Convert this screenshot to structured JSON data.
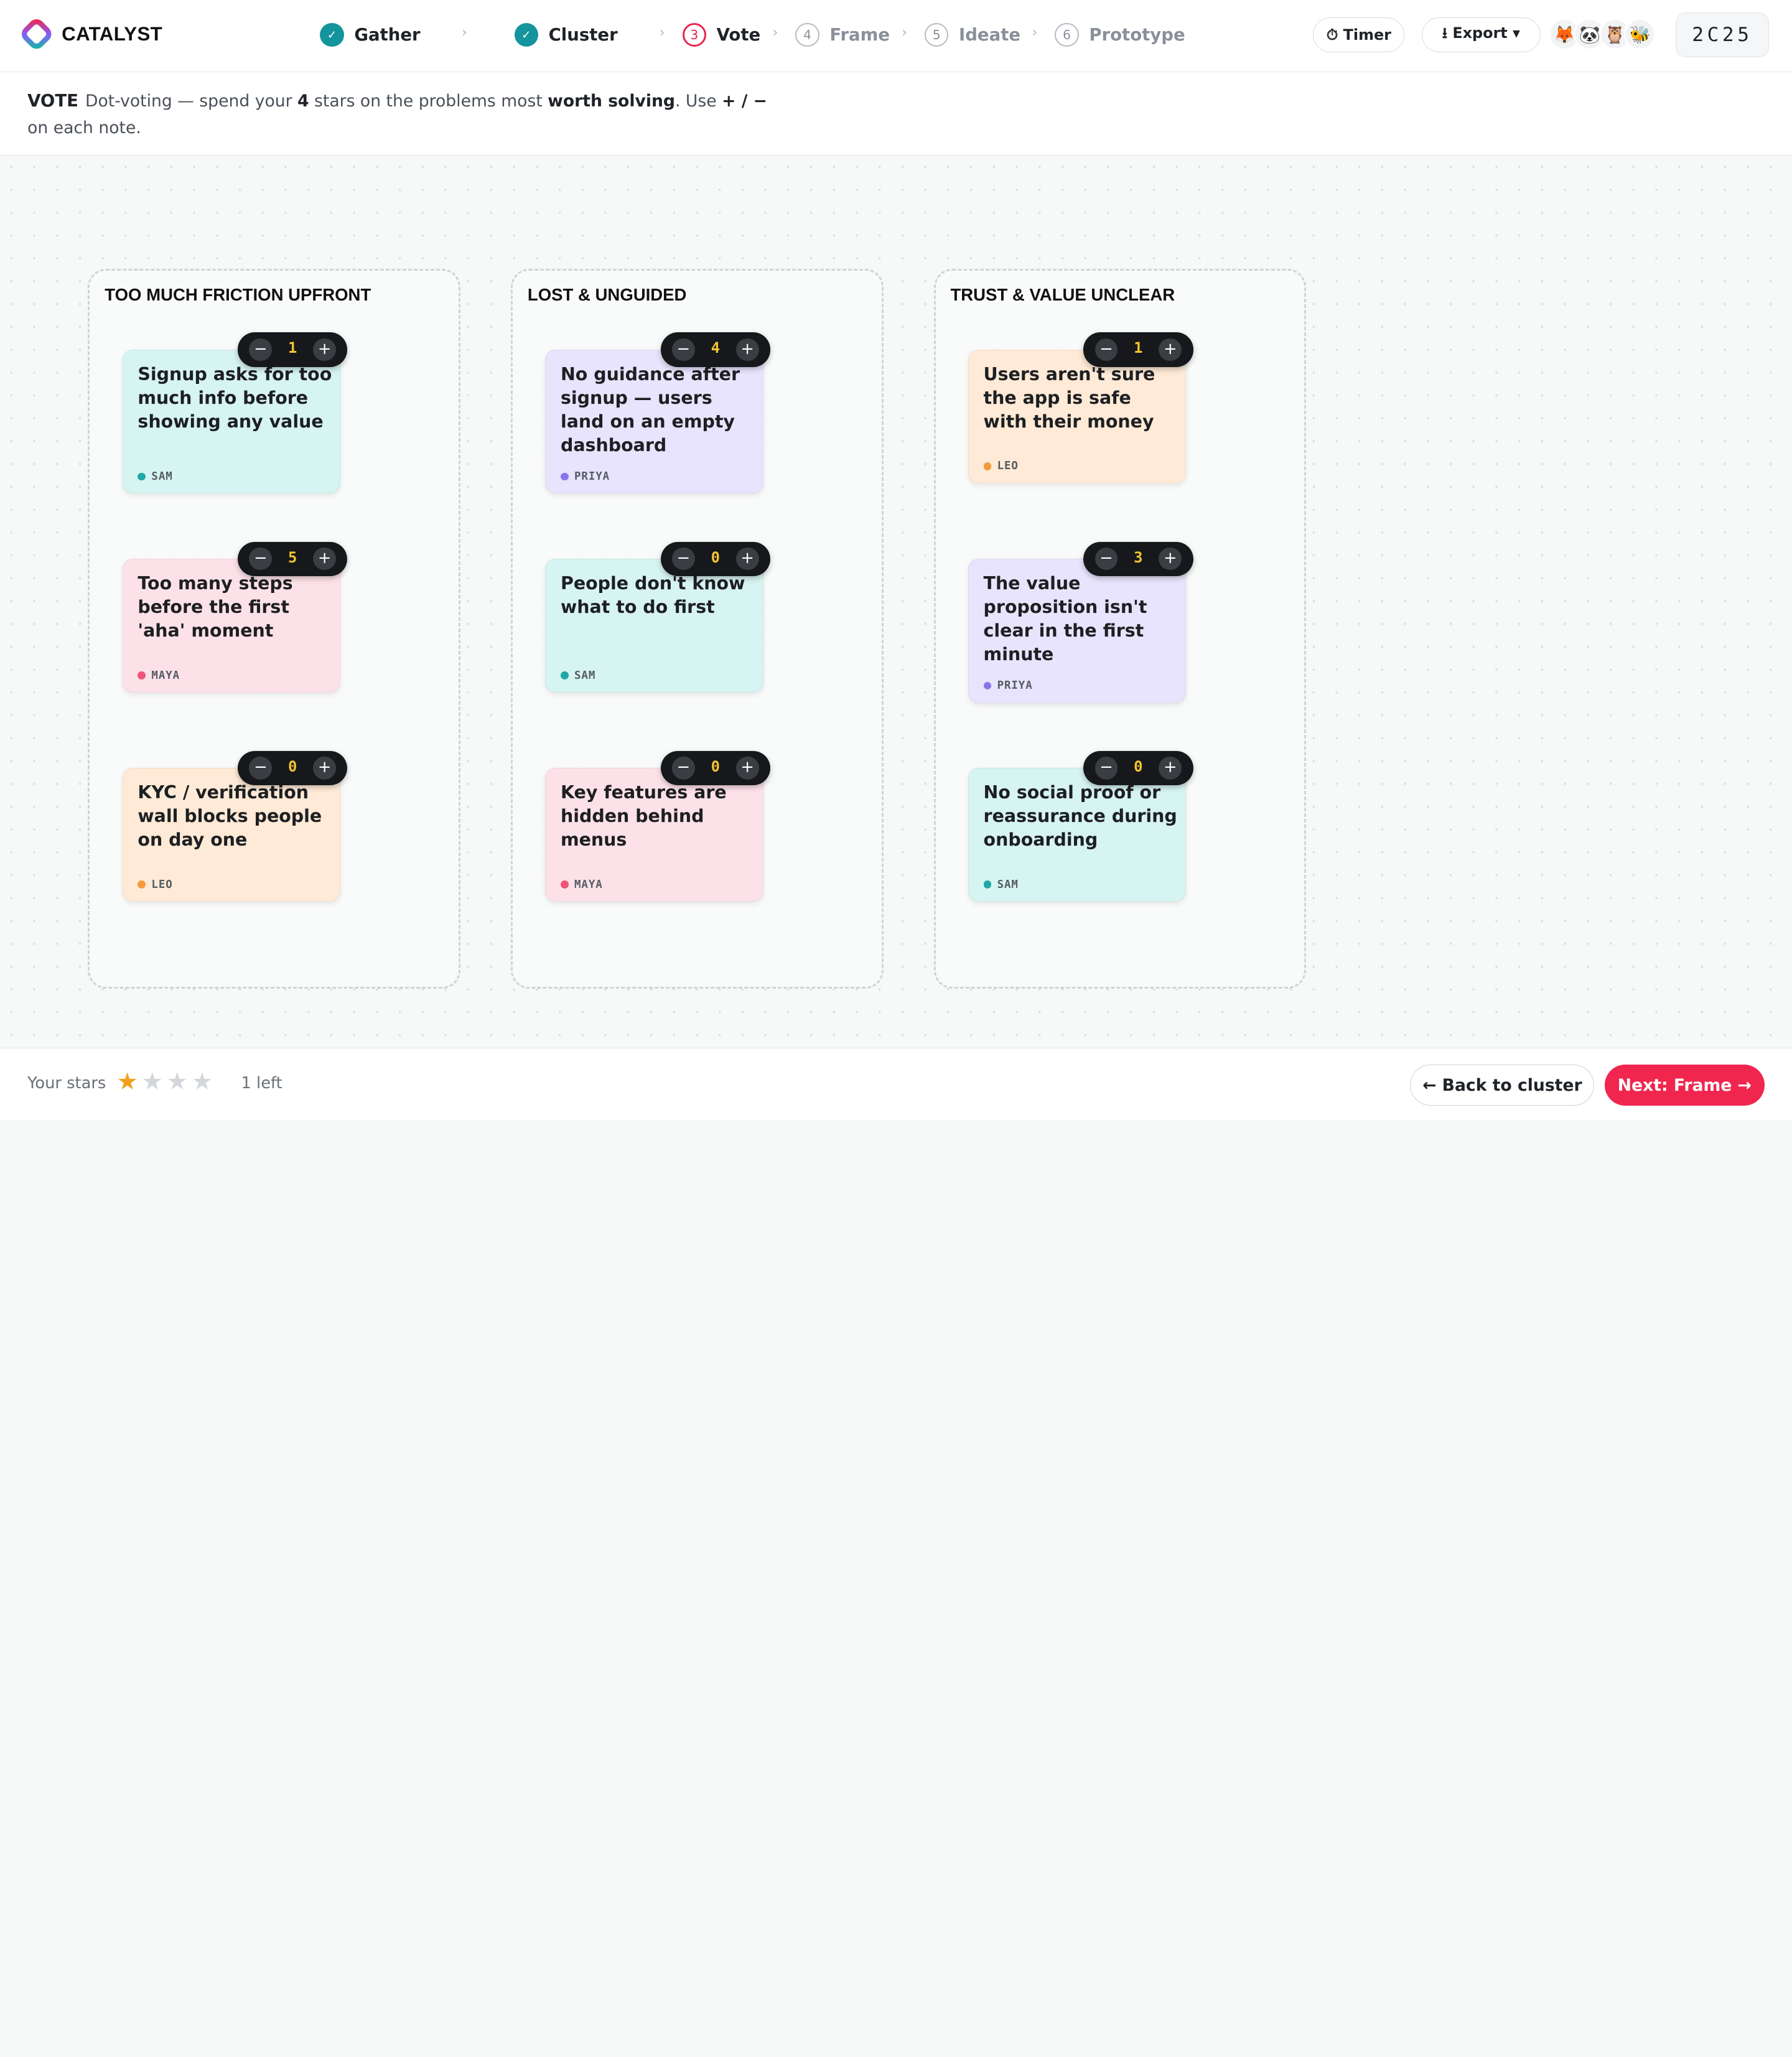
{
  "brand": {
    "name": "CATALYST",
    "accent": "#f0264f"
  },
  "steps": [
    {
      "num": "✓",
      "label": "Gather",
      "status": "done"
    },
    {
      "num": "✓",
      "label": "Cluster",
      "status": "done"
    },
    {
      "num": "3",
      "label": "Vote",
      "status": "current"
    },
    {
      "num": "4",
      "label": "Frame",
      "status": "todo"
    },
    {
      "num": "5",
      "label": "Ideate",
      "status": "todo"
    },
    {
      "num": "6",
      "label": "Prototype",
      "status": "todo"
    }
  ],
  "header": {
    "timer_label": "⏱ Timer",
    "export_label": "⭳ Export ▾",
    "avatars": [
      "🦊",
      "🐼",
      "🦉",
      "🐝"
    ],
    "room_code": "2C25"
  },
  "instruction": {
    "phase": "VOTE",
    "text_1": "Dot-voting — spend your ",
    "stars": "4",
    "text_2": " stars on the problems most ",
    "emph": "worth solving",
    "text_3": ". Use ",
    "keys": "+ / −",
    "text_4": " on each note."
  },
  "clusters": [
    {
      "title": "TOO MUCH FRICTION UPFRONT",
      "notes": [
        {
          "text": "Signup asks for too much info before showing any value",
          "author": "SAM",
          "votes": "1",
          "color": "teal"
        },
        {
          "text": "Too many steps before the first 'aha' moment",
          "author": "MAYA",
          "votes": "5",
          "color": "pink"
        },
        {
          "text": "KYC / verification wall blocks people on day one",
          "author": "LEO",
          "votes": "0",
          "color": "peach"
        }
      ]
    },
    {
      "title": "LOST & UNGUIDED",
      "notes": [
        {
          "text": "No guidance after signup — users land on an empty dashboard",
          "author": "PRIYA",
          "votes": "4",
          "color": "lav"
        },
        {
          "text": "People don't know what to do first",
          "author": "SAM",
          "votes": "0",
          "color": "teal"
        },
        {
          "text": "Key features are hidden behind menus",
          "author": "MAYA",
          "votes": "0",
          "color": "pink"
        }
      ]
    },
    {
      "title": "TRUST & VALUE UNCLEAR",
      "notes": [
        {
          "text": "Users aren't sure the app is safe with their money",
          "author": "LEO",
          "votes": "1",
          "color": "peach"
        },
        {
          "text": "The value proposition isn't clear in the first minute",
          "author": "PRIYA",
          "votes": "3",
          "color": "lav"
        },
        {
          "text": "No social proof or reassurance during onboarding",
          "author": "SAM",
          "votes": "0",
          "color": "teal"
        }
      ]
    }
  ],
  "author_colors": {
    "SAM": "#1fa9a6",
    "MAYA": "#ef5479",
    "LEO": "#f59a3c",
    "PRIYA": "#8b74ea"
  },
  "voter": {
    "minus": "−",
    "plus": "+"
  },
  "footer": {
    "stars_label": "Your stars",
    "stars_total": 4,
    "stars_remaining": 1,
    "stars_left_text": "1 left",
    "back_label": "← Back to cluster",
    "next_label": "Next: Frame →"
  }
}
